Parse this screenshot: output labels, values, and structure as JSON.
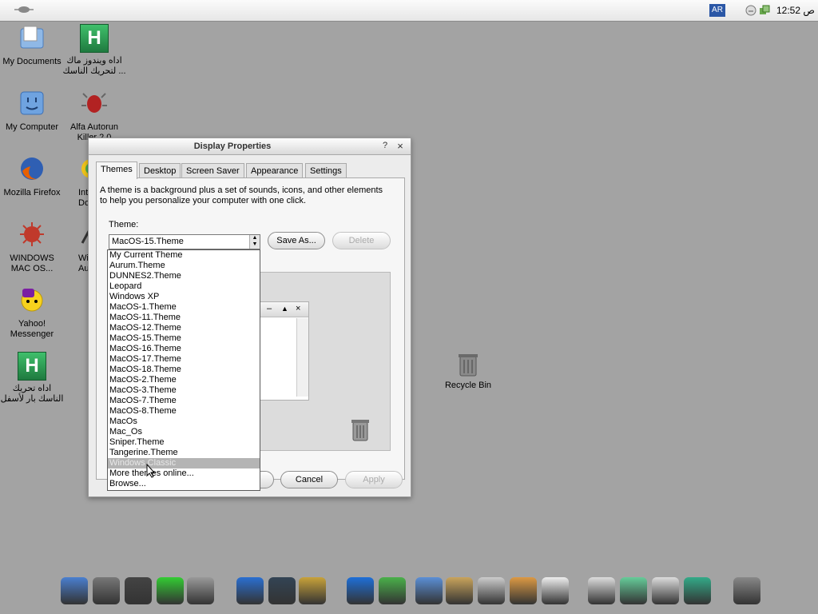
{
  "menubar": {
    "lang_badge": "AR",
    "clock": "12:52 ص"
  },
  "desktop_icons": [
    {
      "label": "My Documents"
    },
    {
      "label": "اداه ويندوز ماك لتحريك الناسك ..."
    },
    {
      "label": "My Computer"
    },
    {
      "label": "Alfa Autorun Killer 2.0"
    },
    {
      "label": "Mozilla Firefox"
    },
    {
      "label": "Int Dov"
    },
    {
      "label": "WINDOWS MAC OS..."
    },
    {
      "label": "Wi Audi"
    },
    {
      "label": "Yahoo! Messenger"
    },
    {
      "label": "اداه تحريك الناسك بار لأسفل"
    },
    {
      "label": "Recycle Bin"
    }
  ],
  "dialog": {
    "title": "Display Properties",
    "help_glyph": "?",
    "close_glyph": "×",
    "tabs": [
      "Themes",
      "Desktop",
      "Screen Saver",
      "Appearance",
      "Settings"
    ],
    "description": "A theme is a background plus a set of sounds, icons, and other elements to help you personalize your computer with one click.",
    "theme_label": "Theme:",
    "theme_value": "MacOS-15.Theme",
    "save_as": "Save As...",
    "delete": "Delete",
    "ok": "OK",
    "cancel": "Cancel",
    "apply": "Apply",
    "preview_controls": [
      "–",
      "▲",
      "×"
    ]
  },
  "theme_options": [
    "My Current Theme",
    "Aurum.Theme",
    "DUNNES2.Theme",
    "Leopard",
    "Windows XP",
    "MacOS-1.Theme",
    "MacOS-11.Theme",
    "MacOS-12.Theme",
    "MacOS-15.Theme",
    "MacOS-16.Theme",
    "MacOS-17.Theme",
    "MacOS-18.Theme",
    "MacOS-2.Theme",
    "MacOS-3.Theme",
    "MacOS-7.Theme",
    "MacOS-8.Theme",
    "MacOs",
    "Mac_Os",
    "Sniper.Theme",
    "Tangerine.Theme",
    "Windows Classic",
    "More themes online...",
    "Browse..."
  ],
  "highlighted_option": "Windows Classic",
  "dock_icons": [
    "finder-icon",
    "system-preferences-icon",
    "power-icon",
    "signal-icon",
    "drive-icon",
    "itunes-icon",
    "movie-icon",
    "spotlight-icon",
    "internet-explorer-icon",
    "messenger-icon",
    "mail-icon",
    "address-book-icon",
    "calculator-icon",
    "applications-icon",
    "textedit-icon",
    "stack-icon",
    "windows-icon",
    "stack-icon",
    "downloads-icon",
    "trash-icon"
  ],
  "colors": {
    "desktop": "#a3a3a3",
    "selection": "#b4b4b4",
    "accent": "#2b57a6"
  }
}
